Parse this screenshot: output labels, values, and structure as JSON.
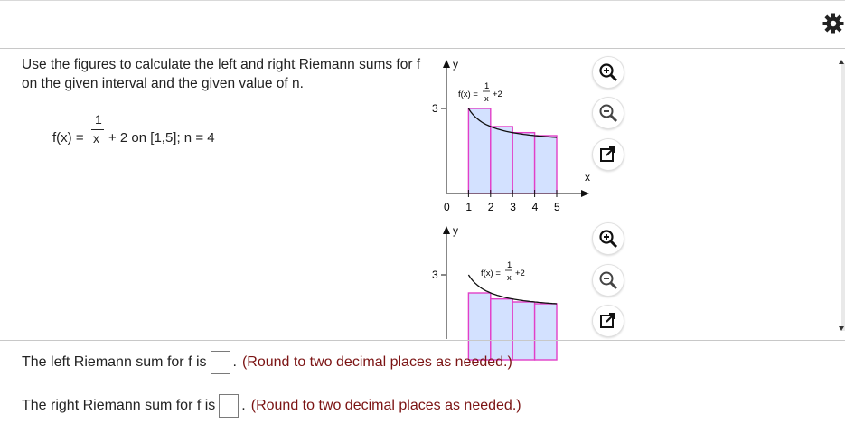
{
  "header": {
    "settings_icon": "gear-icon"
  },
  "problem": {
    "instruction": "Use the figures to calculate the left and right Riemann sums for f on the given interval and the given value of n.",
    "formula": {
      "lhs": "f(x) =",
      "numerator": "1",
      "denominator": "x",
      "rhs": "+ 2 on [1,5]; n = 4"
    }
  },
  "graphs": [
    {
      "id": "left",
      "y_axis_label": "y",
      "x_axis_label": "x",
      "y_tick_label": "3",
      "x_tick_labels": [
        "0",
        "1",
        "2",
        "3",
        "4",
        "5"
      ],
      "func_label": {
        "lhs": "f(x) =",
        "num": "1",
        "den": "x",
        "rhs": "+2"
      },
      "rect_heights": [
        3,
        2.5,
        2.333,
        2.25
      ],
      "fill_color": "#d3e1ff",
      "stroke_color": "#e23fc8",
      "curve_color": "#111111",
      "buttons": [
        "zoom-in-icon",
        "zoom-out-icon",
        "external-link-icon"
      ]
    },
    {
      "id": "right",
      "y_axis_label": "y",
      "y_tick_label": "3",
      "func_label": {
        "lhs": "f(x) =",
        "num": "1",
        "den": "x",
        "rhs": "+2"
      },
      "rect_heights": [
        2.5,
        2.333,
        2.25,
        2.2
      ],
      "fill_color": "#d3e1ff",
      "stroke_color": "#e23fc8",
      "curve_color": "#111111",
      "buttons": [
        "zoom-in-icon",
        "zoom-out-icon",
        "external-link-icon"
      ]
    }
  ],
  "answers": {
    "left": {
      "label": "The left Riemann sum for f is",
      "value": "",
      "suffix": ".",
      "hint": "(Round to two decimal places as needed.)"
    },
    "right": {
      "label": "The right Riemann sum for f is",
      "value": "",
      "suffix": ".",
      "hint": "(Round to two decimal places as needed.)"
    }
  }
}
